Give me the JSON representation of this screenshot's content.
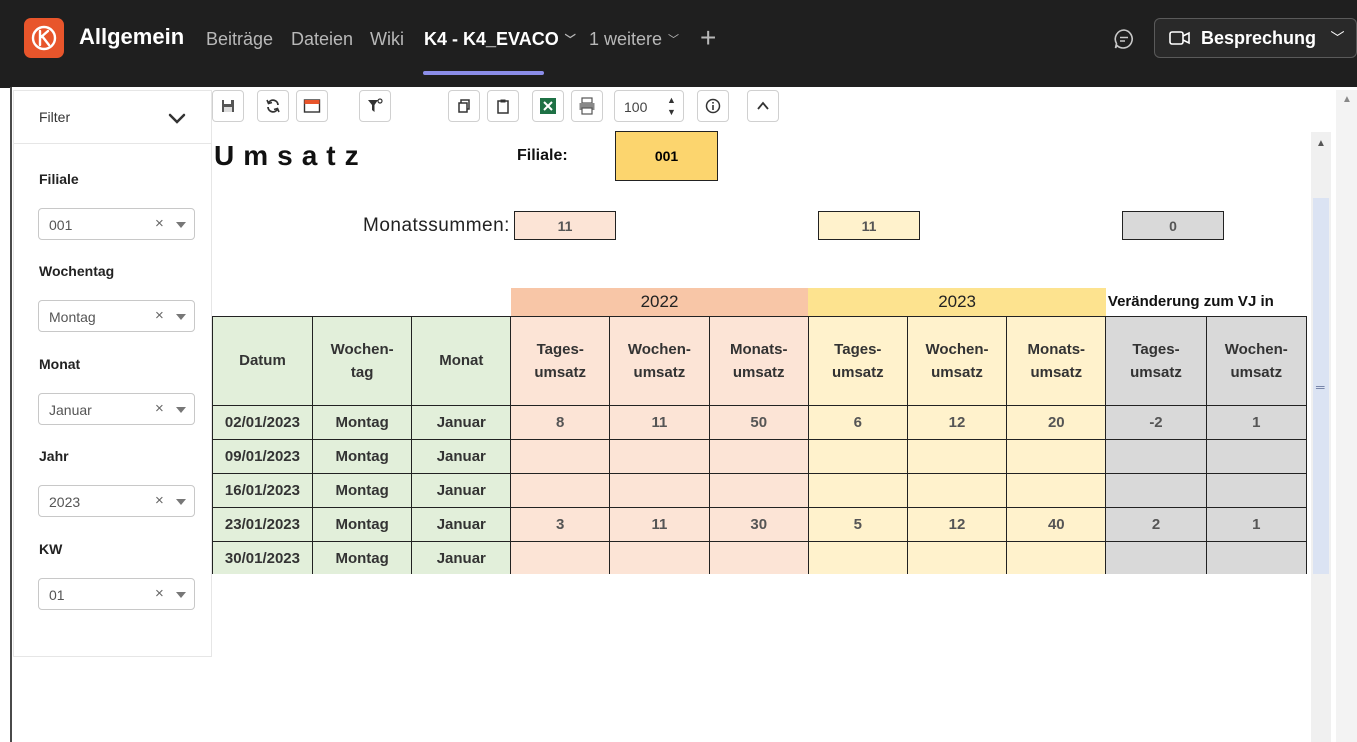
{
  "topbar": {
    "channel_title": "Allgemein",
    "tabs": [
      {
        "label": "Beiträge"
      },
      {
        "label": "Dateien"
      },
      {
        "label": "Wiki"
      },
      {
        "label": "K4 - K4_EVACO"
      },
      {
        "label": "1 weitere"
      }
    ],
    "add_tab": "+",
    "meeting_label": "Besprechung"
  },
  "filter": {
    "title": "Filter",
    "fields": [
      {
        "label": "Filiale",
        "value": "001"
      },
      {
        "label": "Wochentag",
        "value": "Montag"
      },
      {
        "label": "Monat",
        "value": "Januar"
      },
      {
        "label": "Jahr",
        "value": "2023"
      },
      {
        "label": "KW",
        "value": "01"
      }
    ],
    "clear_glyph": "×"
  },
  "toolbar": {
    "zoom_value": "100"
  },
  "sheet": {
    "title": "Umsatz",
    "filiale_label": "Filiale:",
    "filiale_value": "001",
    "monatssummen_label": "Monatssummen:",
    "monatssummen": [
      "11",
      "11",
      "0"
    ],
    "groups": {
      "y2022": "2022",
      "y2023": "2023",
      "vj": "Veränderung zum VJ in"
    },
    "headers": {
      "datum": "Datum",
      "wochentag_1": "Wochen-",
      "wochentag_2": "tag",
      "monat": "Monat",
      "tages_1": "Tages-",
      "tages_2": "umsatz",
      "wochen_1": "Wochen-",
      "wochen_2": "umsatz",
      "monats_1": "Monats-",
      "monats_2": "umsatz"
    },
    "rows": [
      {
        "datum": "02/01/2023",
        "wochentag": "Montag",
        "monat": "Januar",
        "t22": "8",
        "w22": "11",
        "m22": "50",
        "t23": "6",
        "w23": "12",
        "m23": "20",
        "tvj": "-2",
        "wvj": "1"
      },
      {
        "datum": "09/01/2023",
        "wochentag": "Montag",
        "monat": "Januar",
        "t22": "",
        "w22": "",
        "m22": "",
        "t23": "",
        "w23": "",
        "m23": "",
        "tvj": "",
        "wvj": ""
      },
      {
        "datum": "16/01/2023",
        "wochentag": "Montag",
        "monat": "Januar",
        "t22": "",
        "w22": "",
        "m22": "",
        "t23": "",
        "w23": "",
        "m23": "",
        "tvj": "",
        "wvj": ""
      },
      {
        "datum": "23/01/2023",
        "wochentag": "Montag",
        "monat": "Januar",
        "t22": "3",
        "w22": "11",
        "m22": "30",
        "t23": "5",
        "w23": "12",
        "m23": "40",
        "tvj": "2",
        "wvj": "1"
      },
      {
        "datum": "30/01/2023",
        "wochentag": "Montag",
        "monat": "Januar",
        "t22": "",
        "w22": "",
        "m22": "",
        "t23": "",
        "w23": "",
        "m23": "",
        "tvj": "",
        "wvj": ""
      }
    ]
  },
  "colors": {
    "accent": "#8b8de8",
    "logo": "#e8552b",
    "y2022_header": "#f8c6a7",
    "y2023_header": "#fde38f",
    "filiale_highlight": "#fcd56e"
  }
}
